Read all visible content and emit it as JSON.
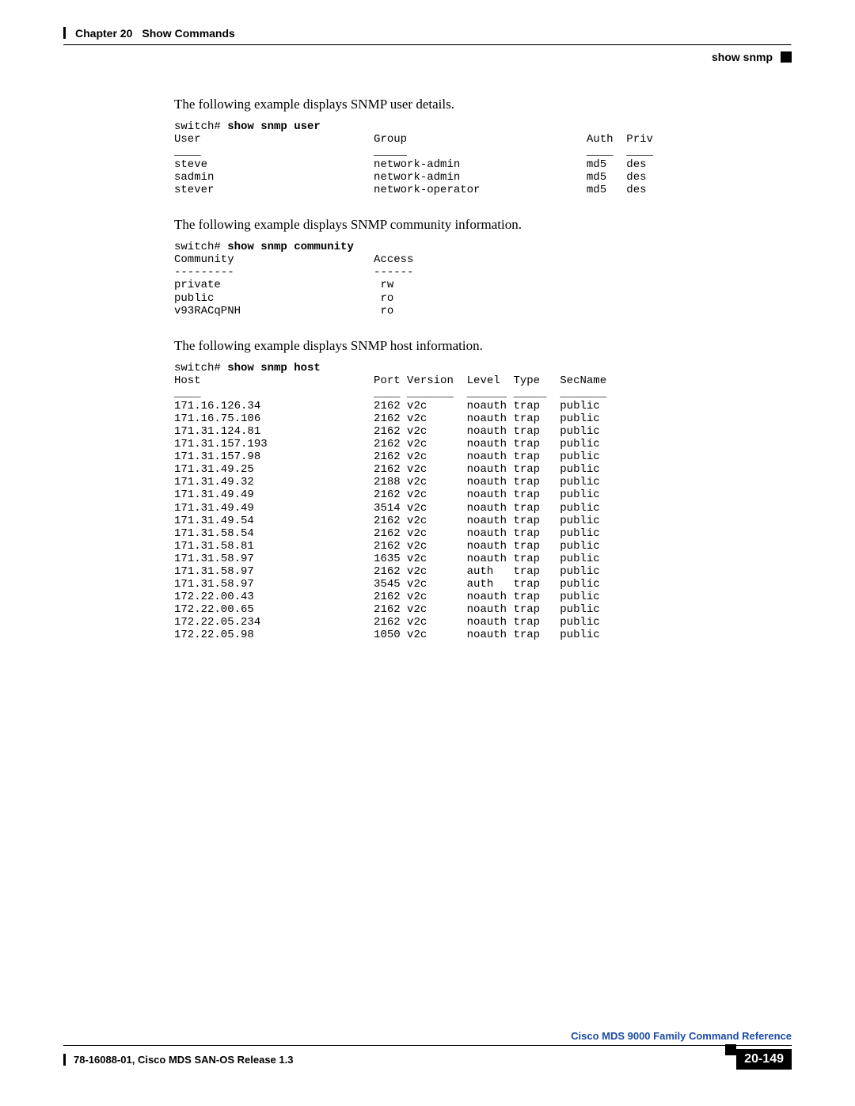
{
  "header": {
    "chapter_label": "Chapter 20",
    "chapter_title": "Show Commands",
    "section_title": "show snmp"
  },
  "body": {
    "para1": "The following example displays SNMP user details.",
    "block1_prompt": "switch# ",
    "block1_cmd": "show snmp user",
    "block1_rest": "\nUser                          Group                           Auth  Priv\n____                          _____                           ____  ____\nsteve                         network-admin                   md5   des\nsadmin                        network-admin                   md5   des\nstever                        network-operator                md5   des",
    "para2": "The following example displays SNMP community information.",
    "block2_prompt": "switch# ",
    "block2_cmd": "show snmp community",
    "block2_rest": "\nCommunity                     Access\n---------                     ------\nprivate                        rw\npublic                         ro\nv93RACqPNH                     ro",
    "para3": "The following example displays SNMP host information.",
    "block3_prompt": "switch# ",
    "block3_cmd": "show snmp host",
    "block3_rest": "\nHost                          Port Version  Level  Type   SecName\n____                          ____ _______  ______ _____  _______\n171.16.126.34                 2162 v2c      noauth trap   public\n171.16.75.106                 2162 v2c      noauth trap   public\n171.31.124.81                 2162 v2c      noauth trap   public\n171.31.157.193                2162 v2c      noauth trap   public\n171.31.157.98                 2162 v2c      noauth trap   public\n171.31.49.25                  2162 v2c      noauth trap   public\n171.31.49.32                  2188 v2c      noauth trap   public\n171.31.49.49                  2162 v2c      noauth trap   public\n171.31.49.49                  3514 v2c      noauth trap   public\n171.31.49.54                  2162 v2c      noauth trap   public\n171.31.58.54                  2162 v2c      noauth trap   public\n171.31.58.81                  2162 v2c      noauth trap   public\n171.31.58.97                  1635 v2c      noauth trap   public\n171.31.58.97                  2162 v2c      auth   trap   public\n171.31.58.97                  3545 v2c      auth   trap   public\n172.22.00.43                  2162 v2c      noauth trap   public\n172.22.00.65                  2162 v2c      noauth trap   public\n172.22.05.234                 2162 v2c      noauth trap   public\n172.22.05.98                  1050 v2c      noauth trap   public"
  },
  "footer": {
    "book_title": "Cisco MDS 9000 Family Command Reference",
    "doc_id": "78-16088-01, Cisco MDS SAN-OS Release 1.3",
    "page_number": "20-149"
  }
}
